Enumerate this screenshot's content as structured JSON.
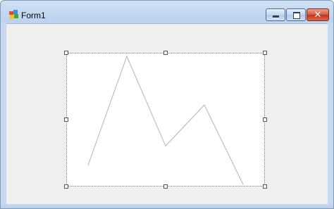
{
  "window": {
    "title": "Form1",
    "buttons": {
      "minimize": "minimize",
      "maximize": "maximize",
      "close": "close"
    },
    "close_glyph": "✕",
    "colors": {
      "frame": "#bcd3ee",
      "client": "#f0f0f0",
      "close_button": "#c6321a"
    }
  },
  "chart_control": {
    "selected": true,
    "chart_data": {
      "type": "line",
      "x": [
        1,
        2,
        3,
        4,
        5
      ],
      "y": [
        0.15,
        1.0,
        0.3,
        0.62,
        0.0
      ],
      "ylim": [
        0,
        1
      ],
      "grid": false,
      "line_color": "#b4b4b4"
    }
  }
}
